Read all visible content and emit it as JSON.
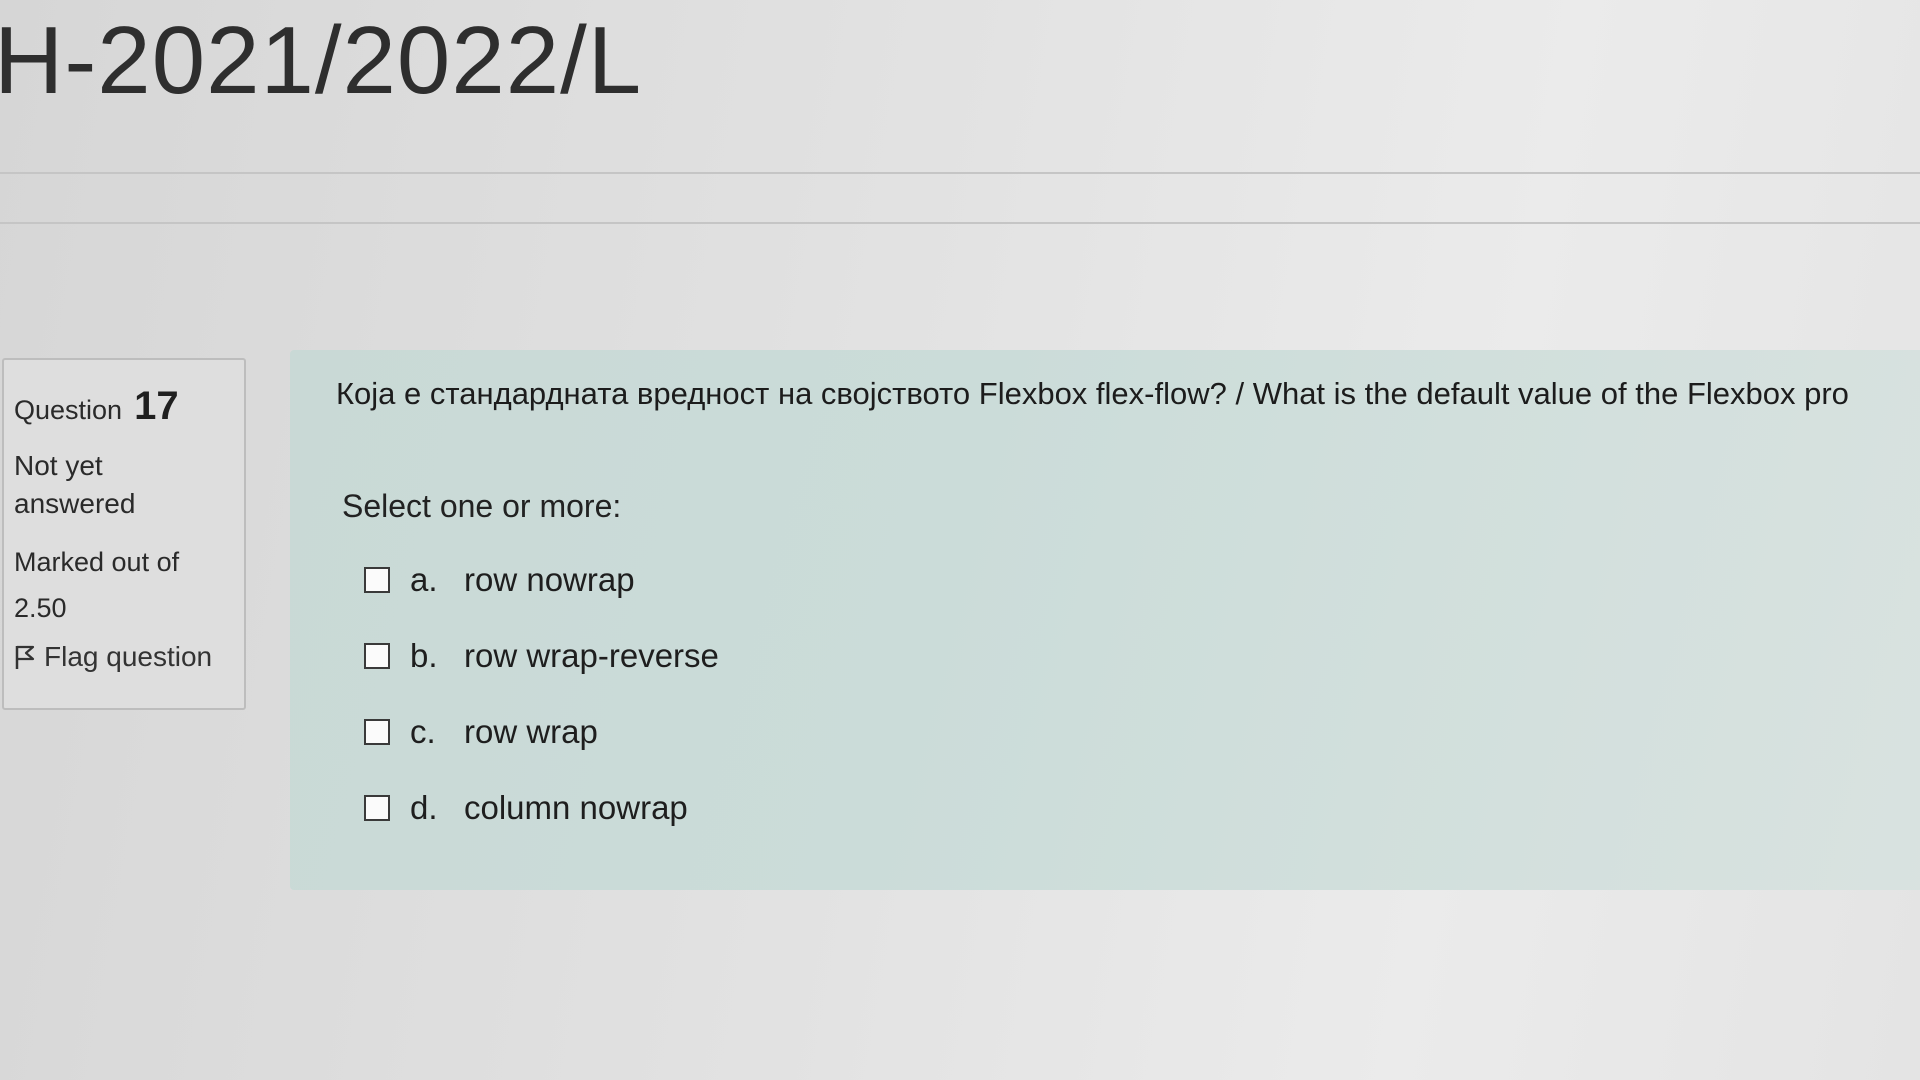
{
  "header": {
    "course_title": "H-2021/2022/L"
  },
  "question_info": {
    "question_label": "Question",
    "question_number": "17",
    "state": "Not yet answered",
    "marked_out_of_label": "Marked out of",
    "marked_out_of_value": "2.50",
    "flag_label": "Flag question",
    "flag_icon": "flag-icon"
  },
  "question": {
    "text": "Која е стандардната вредност на својството Flexbox flex-flow? / What is the default value of the Flexbox pro",
    "prompt": "Select one or more:",
    "options": [
      {
        "letter": "a.",
        "label": "row nowrap",
        "checked": false
      },
      {
        "letter": "b.",
        "label": "row wrap-reverse",
        "checked": false
      },
      {
        "letter": "c.",
        "label": "row wrap",
        "checked": false
      },
      {
        "letter": "d.",
        "label": "column nowrap",
        "checked": false
      }
    ]
  },
  "colors": {
    "content_background": "#cbdcd9",
    "info_background": "#dedede",
    "page_background": "#e2e2e2"
  }
}
